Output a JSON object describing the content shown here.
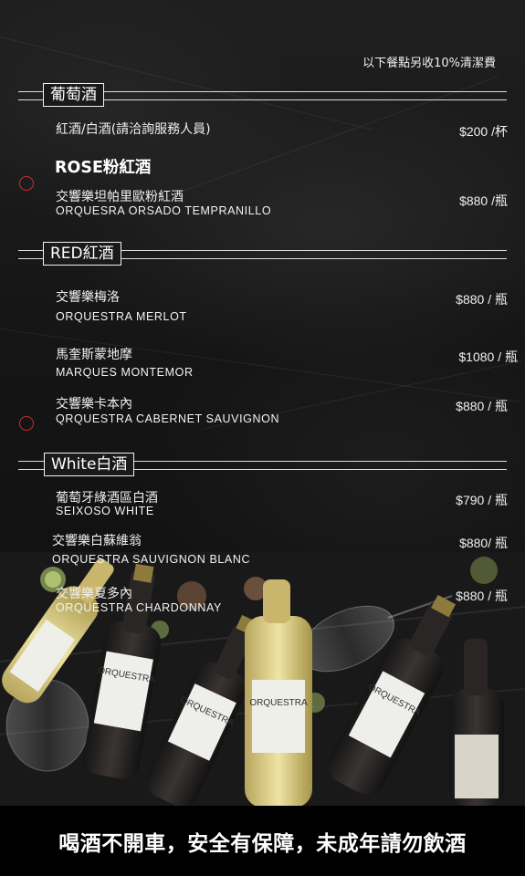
{
  "notice": "以下餐點另收10%清潔費",
  "sections": {
    "grape": {
      "title": "葡萄酒",
      "items": [
        {
          "name": "紅酒/白酒(請洽詢服務人員)",
          "price": "$200 /杯"
        }
      ],
      "rose_title": "ROSE粉紅酒",
      "rose_items": [
        {
          "name": "交響樂坦帕里歐粉紅酒",
          "sub": "ORQUESRA ORSADO TEMPRANILLO",
          "price": "$880 /瓶"
        }
      ]
    },
    "red": {
      "title": "RED紅酒",
      "items": [
        {
          "name": "交響樂梅洛",
          "sub": "ORQUESTRA MERLOT",
          "price": "$880 / 瓶"
        },
        {
          "name": "馬奎斯蒙地摩",
          "sub": "MARQUES MONTEMOR",
          "price": "$1080 / 瓶"
        },
        {
          "name": "交響樂卡本內",
          "sub": "QRQUESTRA CABERNET SAUVIGNON",
          "price": "$880 / 瓶"
        }
      ]
    },
    "white": {
      "title": "White白酒",
      "items": [
        {
          "name": "葡萄牙綠酒區白酒",
          "sub": "SEIXOSO WHITE",
          "price": "$790 / 瓶"
        },
        {
          "name": "交響樂白蘇維翁",
          "sub": "ORQUESTRA SAUVIGNON BLANC",
          "price": "$880/ 瓶"
        },
        {
          "name": "交響樂夏多內",
          "sub": "ORQUESTRA CHARDONNAY",
          "price": "$880 / 瓶"
        }
      ]
    }
  },
  "photo": {
    "bottle_label": "ORQUESTRA"
  },
  "footer": "喝酒不開車，安全有保障，未成年請勿飲酒",
  "colors": {
    "background": "#161616",
    "accent_ring": "#c83038",
    "text": "#f0f0f0",
    "footer_bg": "#000000"
  }
}
